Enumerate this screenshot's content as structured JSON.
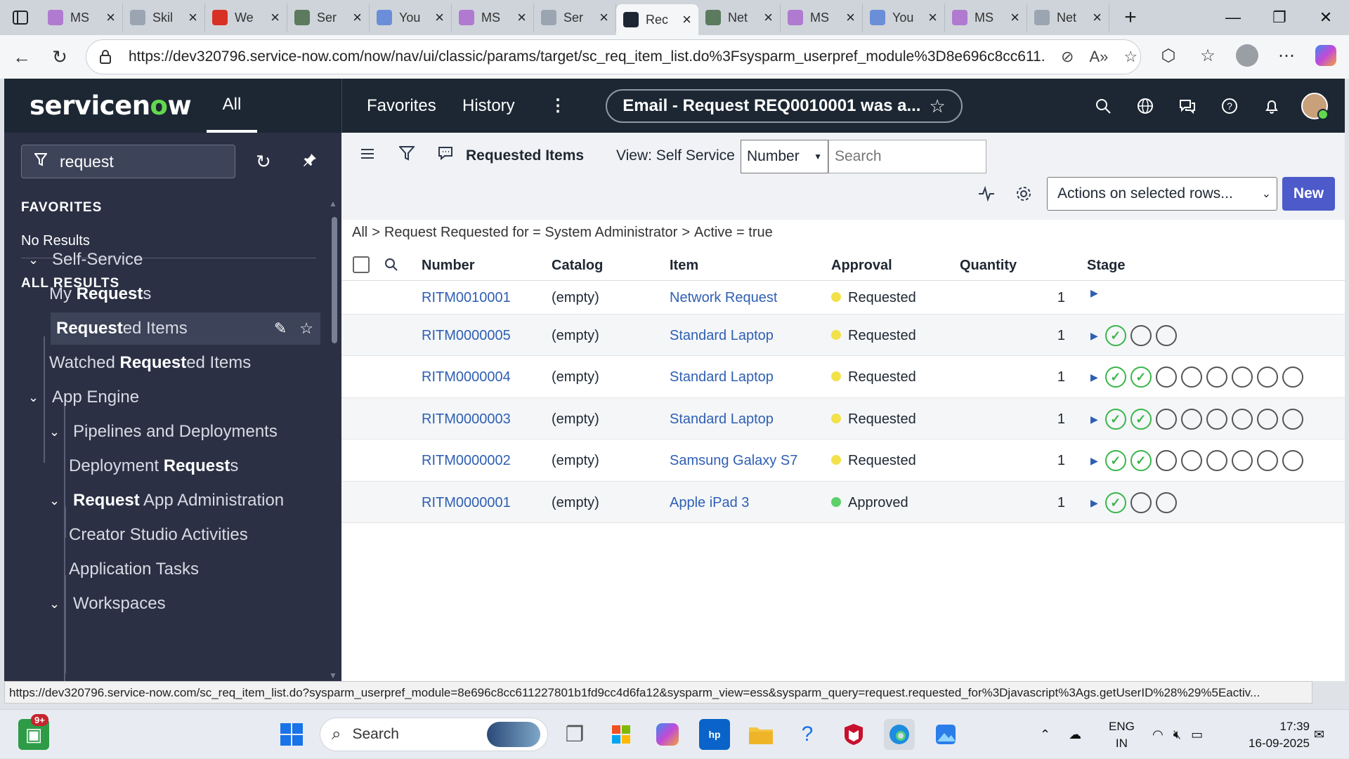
{
  "browser": {
    "tabs": [
      {
        "title": "MS",
        "color": "#b07ad0",
        "active": false
      },
      {
        "title": "Skil",
        "color": "#9aa5b1",
        "active": false
      },
      {
        "title": "We",
        "color": "#d93025",
        "active": false
      },
      {
        "title": "Ser",
        "color": "#5c7a5e",
        "active": false
      },
      {
        "title": "You",
        "color": "#6a8fd8",
        "active": false
      },
      {
        "title": "MS",
        "color": "#b07ad0",
        "active": false
      },
      {
        "title": "Ser",
        "color": "#9aa5b1",
        "active": false
      },
      {
        "title": "Rec",
        "color": "#1c2733",
        "active": true
      },
      {
        "title": "Net",
        "color": "#5c7a5e",
        "active": false
      },
      {
        "title": "MS",
        "color": "#b07ad0",
        "active": false
      },
      {
        "title": "You",
        "color": "#6a8fd8",
        "active": false
      },
      {
        "title": "MS",
        "color": "#b07ad0",
        "active": false
      },
      {
        "title": "Net",
        "color": "#9aa5b1",
        "active": false
      }
    ],
    "url": "https://dev320796.service-now.com/now/nav/ui/classic/params/target/sc_req_item_list.do%3Fsysparm_userpref_module%3D8e696c8cc611...",
    "status_url": "https://dev320796.service-now.com/sc_req_item_list.do?sysparm_userpref_module=8e696c8cc611227801b1fd9cc4d6fa12&sysparm_view=ess&sysparm_query=request.requested_for%3Djavascript%3Ags.getUserID%28%29%5Eactiv..."
  },
  "header": {
    "logo_pre": "servicen",
    "logo_o": "o",
    "logo_post": "w",
    "all_label": "All",
    "favorites_label": "Favorites",
    "history_label": "History",
    "more_label": "⋮",
    "context_title": "Email - Request REQ0010001 was a...",
    "context_star": "☆"
  },
  "sidebar": {
    "filter_value": "request",
    "favorites_heading": "FAVORITES",
    "no_results": "No Results",
    "all_results_heading": "ALL RESULTS",
    "items": [
      {
        "pre": "",
        "bold": "",
        "post": "Self-Service",
        "chev": "⌄"
      },
      {
        "pre": "My ",
        "bold": "Request",
        "post": "s"
      },
      {
        "pre": "",
        "bold": "Request",
        "post": "ed Items"
      },
      {
        "pre": "Watched ",
        "bold": "Request",
        "post": "ed Items"
      },
      {
        "pre": "",
        "bold": "",
        "post": "App Engine",
        "chev": "⌄"
      },
      {
        "pre": "",
        "bold": "",
        "post": "Pipelines and Deployments",
        "chev": "⌄"
      },
      {
        "pre": "Deployment ",
        "bold": "Request",
        "post": "s"
      },
      {
        "pre": "",
        "bold": "Request",
        "post": " App Administration",
        "chev": "⌄"
      },
      {
        "pre": "",
        "bold": "",
        "post": "Creator Studio Activities"
      },
      {
        "pre": "",
        "bold": "",
        "post": "Application Tasks"
      },
      {
        "pre": "",
        "bold": "",
        "post": "Workspaces",
        "chev": "⌄"
      }
    ]
  },
  "list": {
    "title": "Requested Items",
    "view_label": "View: Self Service",
    "search_field": "Number",
    "search_placeholder": "Search",
    "actions_label": "Actions on selected rows...",
    "new_label": "New",
    "breadcrumb": [
      "All",
      "Request Requested for = System Administrator",
      "Active = true"
    ],
    "columns": [
      "Number",
      "Catalog",
      "Item",
      "Approval",
      "Quantity",
      "Stage"
    ],
    "rows": [
      {
        "number": "RITM0010001",
        "catalog": "(empty)",
        "item": "Network Request",
        "approval": "Requested",
        "approval_color": "#f2e14a",
        "quantity": "1",
        "stages_done": 0,
        "stages_total": 0
      },
      {
        "number": "RITM0000005",
        "catalog": "(empty)",
        "item": "Standard Laptop",
        "approval": "Requested",
        "approval_color": "#f2e14a",
        "quantity": "1",
        "stages_done": 1,
        "stages_total": 3
      },
      {
        "number": "RITM0000004",
        "catalog": "(empty)",
        "item": "Standard Laptop",
        "approval": "Requested",
        "approval_color": "#f2e14a",
        "quantity": "1",
        "stages_done": 2,
        "stages_total": 8
      },
      {
        "number": "RITM0000003",
        "catalog": "(empty)",
        "item": "Standard Laptop",
        "approval": "Requested",
        "approval_color": "#f2e14a",
        "quantity": "1",
        "stages_done": 2,
        "stages_total": 8
      },
      {
        "number": "RITM0000002",
        "catalog": "(empty)",
        "item": "Samsung Galaxy S7",
        "approval": "Requested",
        "approval_color": "#f2e14a",
        "quantity": "1",
        "stages_done": 2,
        "stages_total": 8
      },
      {
        "number": "RITM0000001",
        "catalog": "(empty)",
        "item": "Apple iPad 3",
        "approval": "Approved",
        "approval_color": "#5cd16a",
        "quantity": "1",
        "stages_done": 1,
        "stages_total": 3
      }
    ]
  },
  "taskbar": {
    "search_placeholder": "Search",
    "notif_badge": "9+",
    "lang_top": "ENG",
    "lang_bottom": "IN",
    "time": "17:39",
    "date": "16-09-2025"
  }
}
